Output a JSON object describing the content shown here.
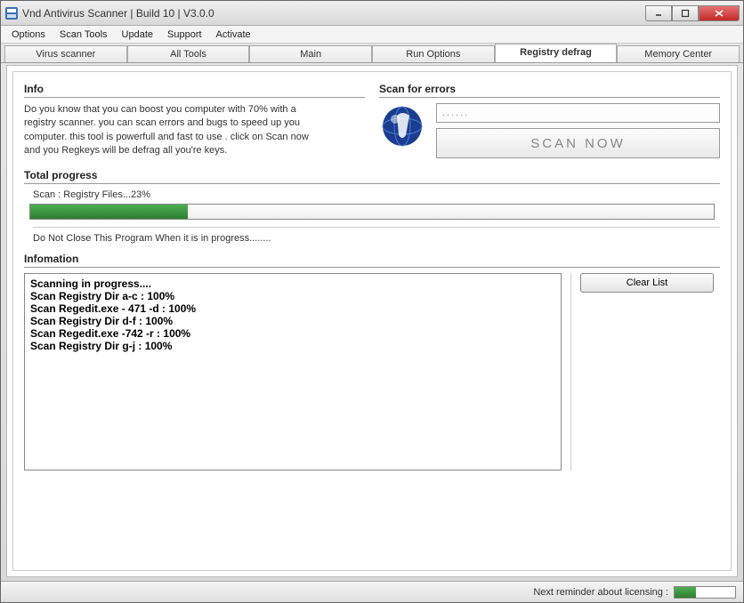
{
  "title": "Vnd Antivirus Scanner | Build 10 | V3.0.0",
  "menu": {
    "options": "Options",
    "scan_tools": "Scan Tools",
    "update": "Update",
    "support": "Support",
    "activate": "Activate"
  },
  "tabs": {
    "virus_scanner": "Virus scanner",
    "all_tools": "All Tools",
    "main": "Main",
    "run_options": "Run Options",
    "registry_defrag": "Registry defrag",
    "memory_center": "Memory Center"
  },
  "info": {
    "title": "Info",
    "text": "Do you know that you can boost you computer with 70% with a registry scanner. you can scan errors and bugs to speed up you computer. this tool is powerfull and fast to use . click on Scan now and you Regkeys will be defrag all you're keys."
  },
  "scan": {
    "title": "Scan for errors",
    "placeholder": "......",
    "button": "SCAN NOW"
  },
  "progress": {
    "title": "Total progress",
    "label": "Scan : Registry Files...23%",
    "percent": 23,
    "note": "Do Not Close This Program When it is in progress........"
  },
  "log": {
    "title": "Infomation",
    "lines": [
      "Scanning in progress....",
      "Scan Registry Dir a-c : 100%",
      "Scan Regedit.exe - 471 -d : 100%",
      "Scan Registry Dir d-f : 100%",
      "Scan Regedit.exe -742 -r : 100%",
      "Scan Registry Dir g-j : 100%"
    ],
    "clear": "Clear List"
  },
  "status": {
    "label": "Next reminder about licensing :",
    "percent": 35
  },
  "icons": {
    "app": "app-icon",
    "globe": "globe-icon"
  }
}
